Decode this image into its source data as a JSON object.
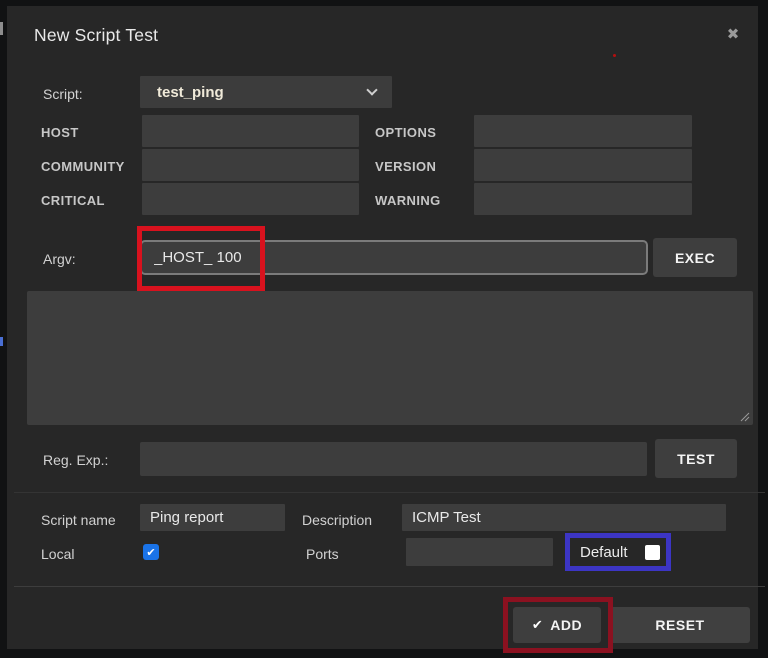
{
  "colors": {
    "annotation_red": "#d8121e",
    "annotation_maroon": "#8b1120",
    "annotation_blue": "#3c35c4",
    "checkbox_blue": "#1a73e8"
  },
  "icons": {
    "close": "✖",
    "check": "✔"
  },
  "dialog": {
    "title": "New Script Test"
  },
  "script_row": {
    "label": "Script:",
    "selected_option": "test_ping"
  },
  "params": {
    "left": [
      {
        "label": "HOST",
        "value": ""
      },
      {
        "label": "COMMUNITY",
        "value": ""
      },
      {
        "label": "CRITICAL",
        "value": ""
      }
    ],
    "right": [
      {
        "label": "OPTIONS",
        "value": ""
      },
      {
        "label": "VERSION",
        "value": ""
      },
      {
        "label": "WARNING",
        "value": ""
      }
    ]
  },
  "argv_row": {
    "label": "Argv:",
    "value": "_HOST_ 100",
    "exec_button": "EXEC"
  },
  "output_box": {
    "value": ""
  },
  "regexp_row": {
    "label": "Reg. Exp.:",
    "value": "",
    "test_button": "TEST"
  },
  "details": {
    "script_name": {
      "label": "Script name",
      "value": "Ping report"
    },
    "description": {
      "label": "Description",
      "value": "ICMP Test"
    },
    "local": {
      "label": "Local",
      "checked": true
    },
    "ports": {
      "label": "Ports",
      "value": ""
    },
    "default": {
      "label": "Default",
      "checked": false
    }
  },
  "footer": {
    "add_button": "ADD",
    "reset_button": "RESET"
  }
}
